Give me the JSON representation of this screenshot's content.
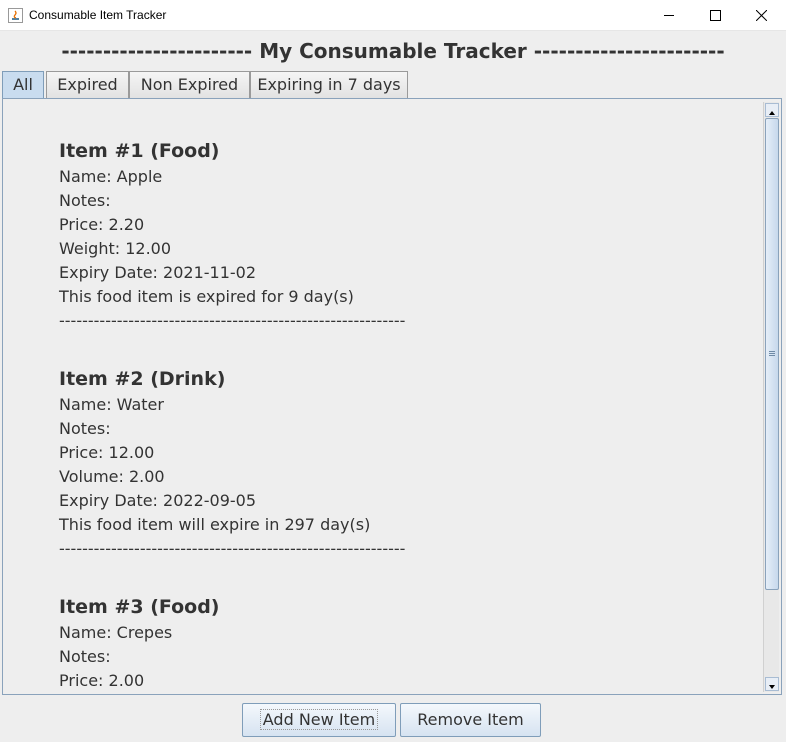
{
  "window": {
    "title": "Consumable Item Tracker",
    "controls": [
      "minimize-icon",
      "maximize-icon",
      "close-icon"
    ]
  },
  "heading": "----------------------- My Consumable Tracker -----------------------",
  "tabs": [
    {
      "label": "All",
      "active": true
    },
    {
      "label": "Expired",
      "active": false
    },
    {
      "label": "Non Expired",
      "active": false
    },
    {
      "label": "Expiring in 7 days",
      "active": false
    }
  ],
  "items": [
    {
      "header": "Item #1 (Food)",
      "name": "Name: Apple",
      "notes": "Notes:",
      "price": "Price: 2.20",
      "measure": "Weight: 12.00",
      "expiry": "Expiry Date: 2021-11-02",
      "status": "This food item is expired for 9 day(s)"
    },
    {
      "header": "Item #2 (Drink)",
      "name": "Name: Water",
      "notes": "Notes:",
      "price": "Price: 12.00",
      "measure": "Volume: 2.00",
      "expiry": "Expiry Date: 2022-09-05",
      "status": "This food item will expire in 297 day(s)"
    },
    {
      "header": "Item #3 (Food)",
      "name": "Name: Crepes",
      "notes": "Notes:",
      "price": "Price: 2.00"
    }
  ],
  "separator": "------------------------------------------------------------",
  "buttons": {
    "add": "Add New Item",
    "remove": "Remove Item"
  },
  "colors": {
    "background": "#eeeeee",
    "active_tab": "#c9dcef",
    "border_accent": "#7f9db9",
    "text": "#333333"
  }
}
